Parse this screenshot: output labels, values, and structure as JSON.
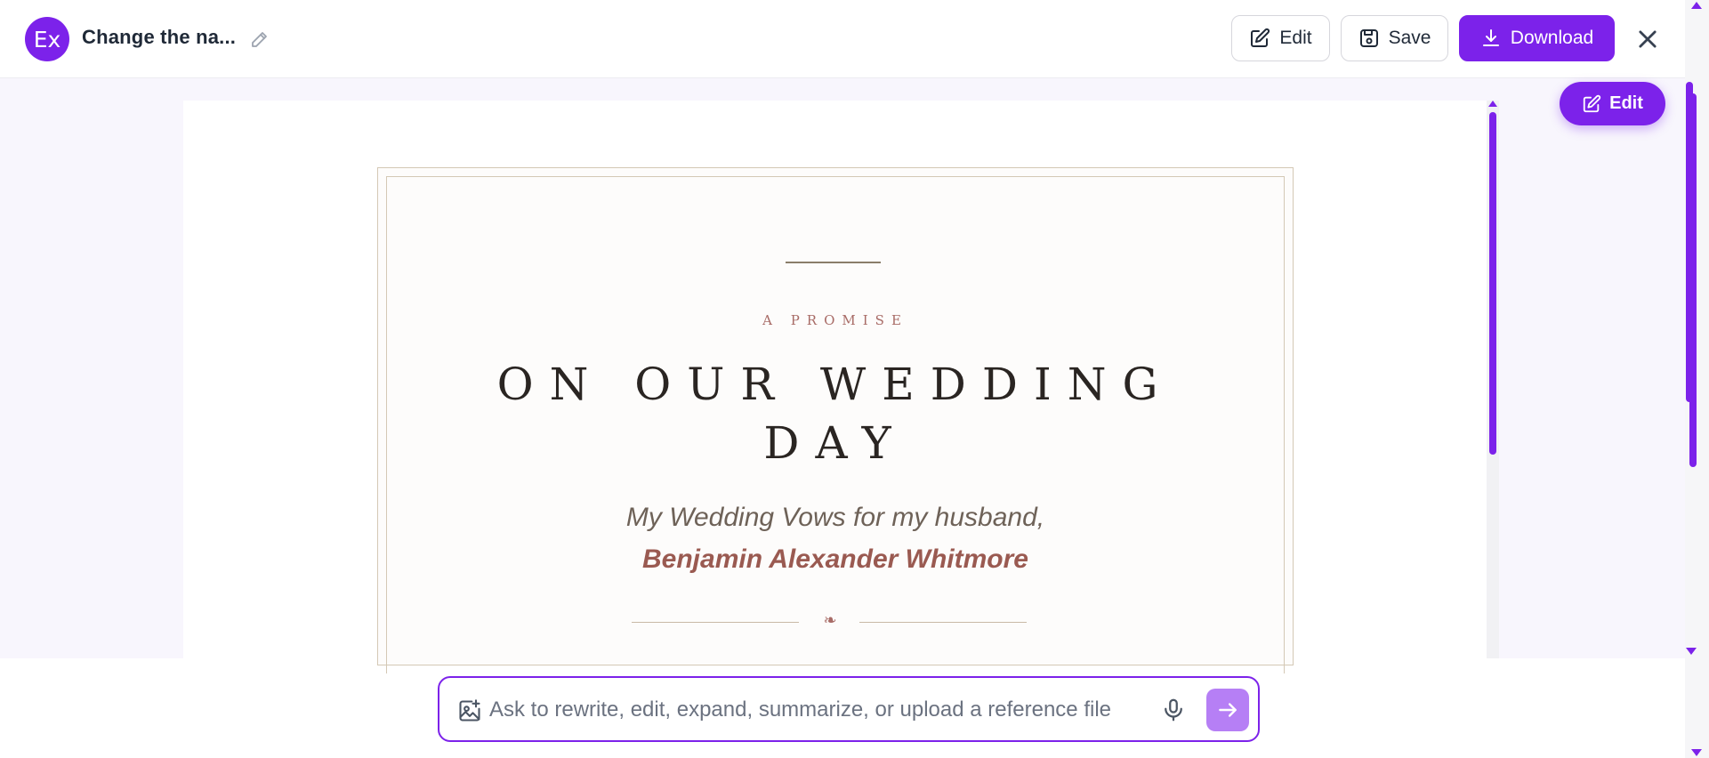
{
  "header": {
    "avatar_text": "Ex",
    "doc_title": "Change the na...",
    "edit_label": "Edit",
    "save_label": "Save",
    "download_label": "Download"
  },
  "document": {
    "eyebrow": "A PROMISE",
    "title_line1": "ON OUR WEDDING",
    "title_line2": "DAY",
    "subtitle": "My Wedding Vows for my husband,",
    "husband_name": "Benjamin Alexander Whitmore",
    "ornament": "❧"
  },
  "floating_edit": {
    "label": "Edit"
  },
  "prompt": {
    "placeholder": "Ask to rewrite, edit, expand, summarize, or upload a reference file"
  },
  "colors": {
    "accent": "#7c22ea",
    "accent_light": "#b67ff5",
    "workspace_bg": "#f8f6fd",
    "title_text": "#2a2522",
    "rose": "#a86b66"
  },
  "icons": [
    "pencil-icon",
    "edit-square-icon",
    "save-disk-icon",
    "download-icon",
    "close-icon",
    "image-attach-icon",
    "microphone-icon",
    "arrow-right-icon"
  ]
}
